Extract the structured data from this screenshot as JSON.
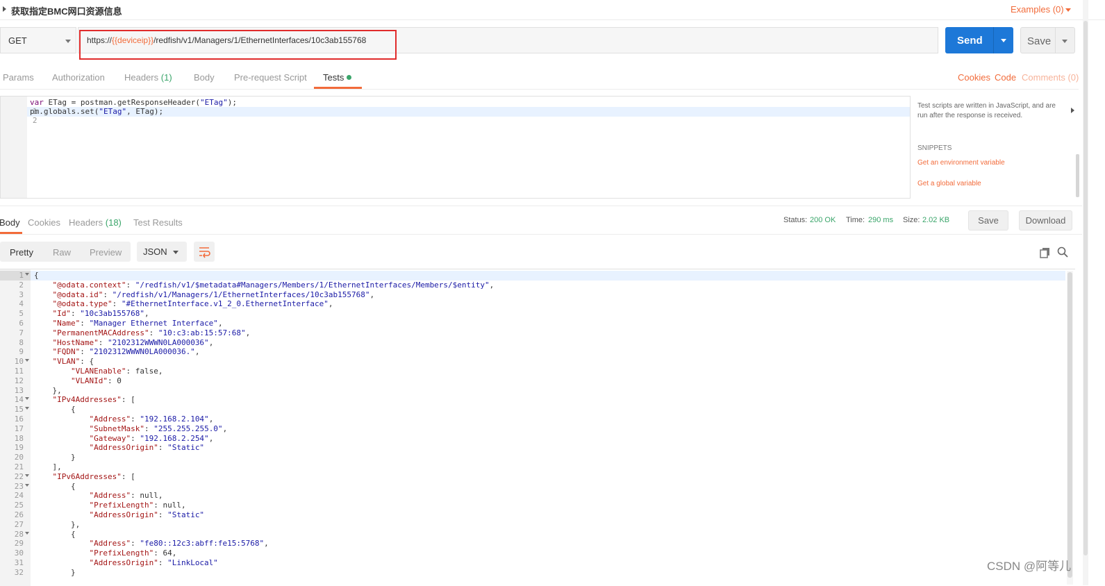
{
  "request": {
    "title": "获取指定BMC网口资源信息",
    "examples_label": "Examples (0)",
    "method": "GET",
    "url_prefix": "https://",
    "url_variable": "{{deviceip}}",
    "url_suffix": "/redfish/v1/Managers/1/EthernetInterfaces/10c3ab155768",
    "send_label": "Send",
    "save_label": "Save"
  },
  "request_tabs": {
    "params": "Params",
    "authorization": "Authorization",
    "headers": "Headers",
    "headers_count": "(1)",
    "body": "Body",
    "pre_request": "Pre-request Script",
    "tests": "Tests",
    "cookies": "Cookies",
    "code": "Code",
    "comments": "Comments (0)"
  },
  "script": {
    "lines": [
      {
        "n": "1",
        "kw": "var",
        "rest": " ETag = postman.getResponseHeader(",
        "str": "\"ETag\"",
        "tail": ");"
      },
      {
        "n": "2",
        "kw": "",
        "rest": "pm.globals.set(",
        "str": "\"ETag\"",
        "tail": ", ETag);"
      }
    ]
  },
  "snippets": {
    "help": "Test scripts are written in JavaScript, and are run after the response is received.",
    "title": "SNIPPETS",
    "items": [
      "Get an environment variable",
      "Get a global variable"
    ]
  },
  "response_tabs": {
    "body": "Body",
    "cookies": "Cookies",
    "headers": "Headers",
    "headers_count": "(18)",
    "test_results": "Test Results"
  },
  "response_meta": {
    "status_label": "Status:",
    "status_value": "200 OK",
    "time_label": "Time:",
    "time_value": "290 ms",
    "size_label": "Size:",
    "size_value": "2.02 KB",
    "save_label": "Save",
    "download_label": "Download"
  },
  "format_bar": {
    "pretty": "Pretty",
    "raw": "Raw",
    "preview": "Preview",
    "language": "JSON"
  },
  "response_body": [
    {
      "n": "1",
      "fold": true,
      "text": "{"
    },
    {
      "n": "2",
      "fold": false,
      "text": "    \"@odata.context\": \"/redfish/v1/$metadata#Managers/Members/1/EthernetInterfaces/Members/$entity\","
    },
    {
      "n": "3",
      "fold": false,
      "text": "    \"@odata.id\": \"/redfish/v1/Managers/1/EthernetInterfaces/10c3ab155768\","
    },
    {
      "n": "4",
      "fold": false,
      "text": "    \"@odata.type\": \"#EthernetInterface.v1_2_0.EthernetInterface\","
    },
    {
      "n": "5",
      "fold": false,
      "text": "    \"Id\": \"10c3ab155768\","
    },
    {
      "n": "6",
      "fold": false,
      "text": "    \"Name\": \"Manager Ethernet Interface\","
    },
    {
      "n": "7",
      "fold": false,
      "text": "    \"PermanentMACAddress\": \"10:c3:ab:15:57:68\","
    },
    {
      "n": "8",
      "fold": false,
      "text": "    \"HostName\": \"2102312WWWN0LA000036\","
    },
    {
      "n": "9",
      "fold": false,
      "text": "    \"FQDN\": \"2102312WWWN0LA000036.\","
    },
    {
      "n": "10",
      "fold": true,
      "text": "    \"VLAN\": {"
    },
    {
      "n": "11",
      "fold": false,
      "text": "        \"VLANEnable\": false,"
    },
    {
      "n": "12",
      "fold": false,
      "text": "        \"VLANId\": 0"
    },
    {
      "n": "13",
      "fold": false,
      "text": "    },"
    },
    {
      "n": "14",
      "fold": true,
      "text": "    \"IPv4Addresses\": ["
    },
    {
      "n": "15",
      "fold": true,
      "text": "        {"
    },
    {
      "n": "16",
      "fold": false,
      "text": "            \"Address\": \"192.168.2.104\","
    },
    {
      "n": "17",
      "fold": false,
      "text": "            \"SubnetMask\": \"255.255.255.0\","
    },
    {
      "n": "18",
      "fold": false,
      "text": "            \"Gateway\": \"192.168.2.254\","
    },
    {
      "n": "19",
      "fold": false,
      "text": "            \"AddressOrigin\": \"Static\""
    },
    {
      "n": "20",
      "fold": false,
      "text": "        }"
    },
    {
      "n": "21",
      "fold": false,
      "text": "    ],"
    },
    {
      "n": "22",
      "fold": true,
      "text": "    \"IPv6Addresses\": ["
    },
    {
      "n": "23",
      "fold": true,
      "text": "        {"
    },
    {
      "n": "24",
      "fold": false,
      "text": "            \"Address\": null,"
    },
    {
      "n": "25",
      "fold": false,
      "text": "            \"PrefixLength\": null,"
    },
    {
      "n": "26",
      "fold": false,
      "text": "            \"AddressOrigin\": \"Static\""
    },
    {
      "n": "27",
      "fold": false,
      "text": "        },"
    },
    {
      "n": "28",
      "fold": true,
      "text": "        {"
    },
    {
      "n": "29",
      "fold": false,
      "text": "            \"Address\": \"fe80::12c3:abff:fe15:5768\","
    },
    {
      "n": "30",
      "fold": false,
      "text": "            \"PrefixLength\": 64,"
    },
    {
      "n": "31",
      "fold": false,
      "text": "            \"AddressOrigin\": \"LinkLocal\""
    },
    {
      "n": "32",
      "fold": false,
      "text": "        }"
    }
  ],
  "watermark": "CSDN @阿等儿",
  "colors": {
    "accent": "#f26b3a",
    "send": "#1d78d8",
    "status_ok": "#3aa56a",
    "json_key": "#a31515",
    "json_string": "#1a1aa6",
    "highlight_box": "#e02b2b"
  }
}
